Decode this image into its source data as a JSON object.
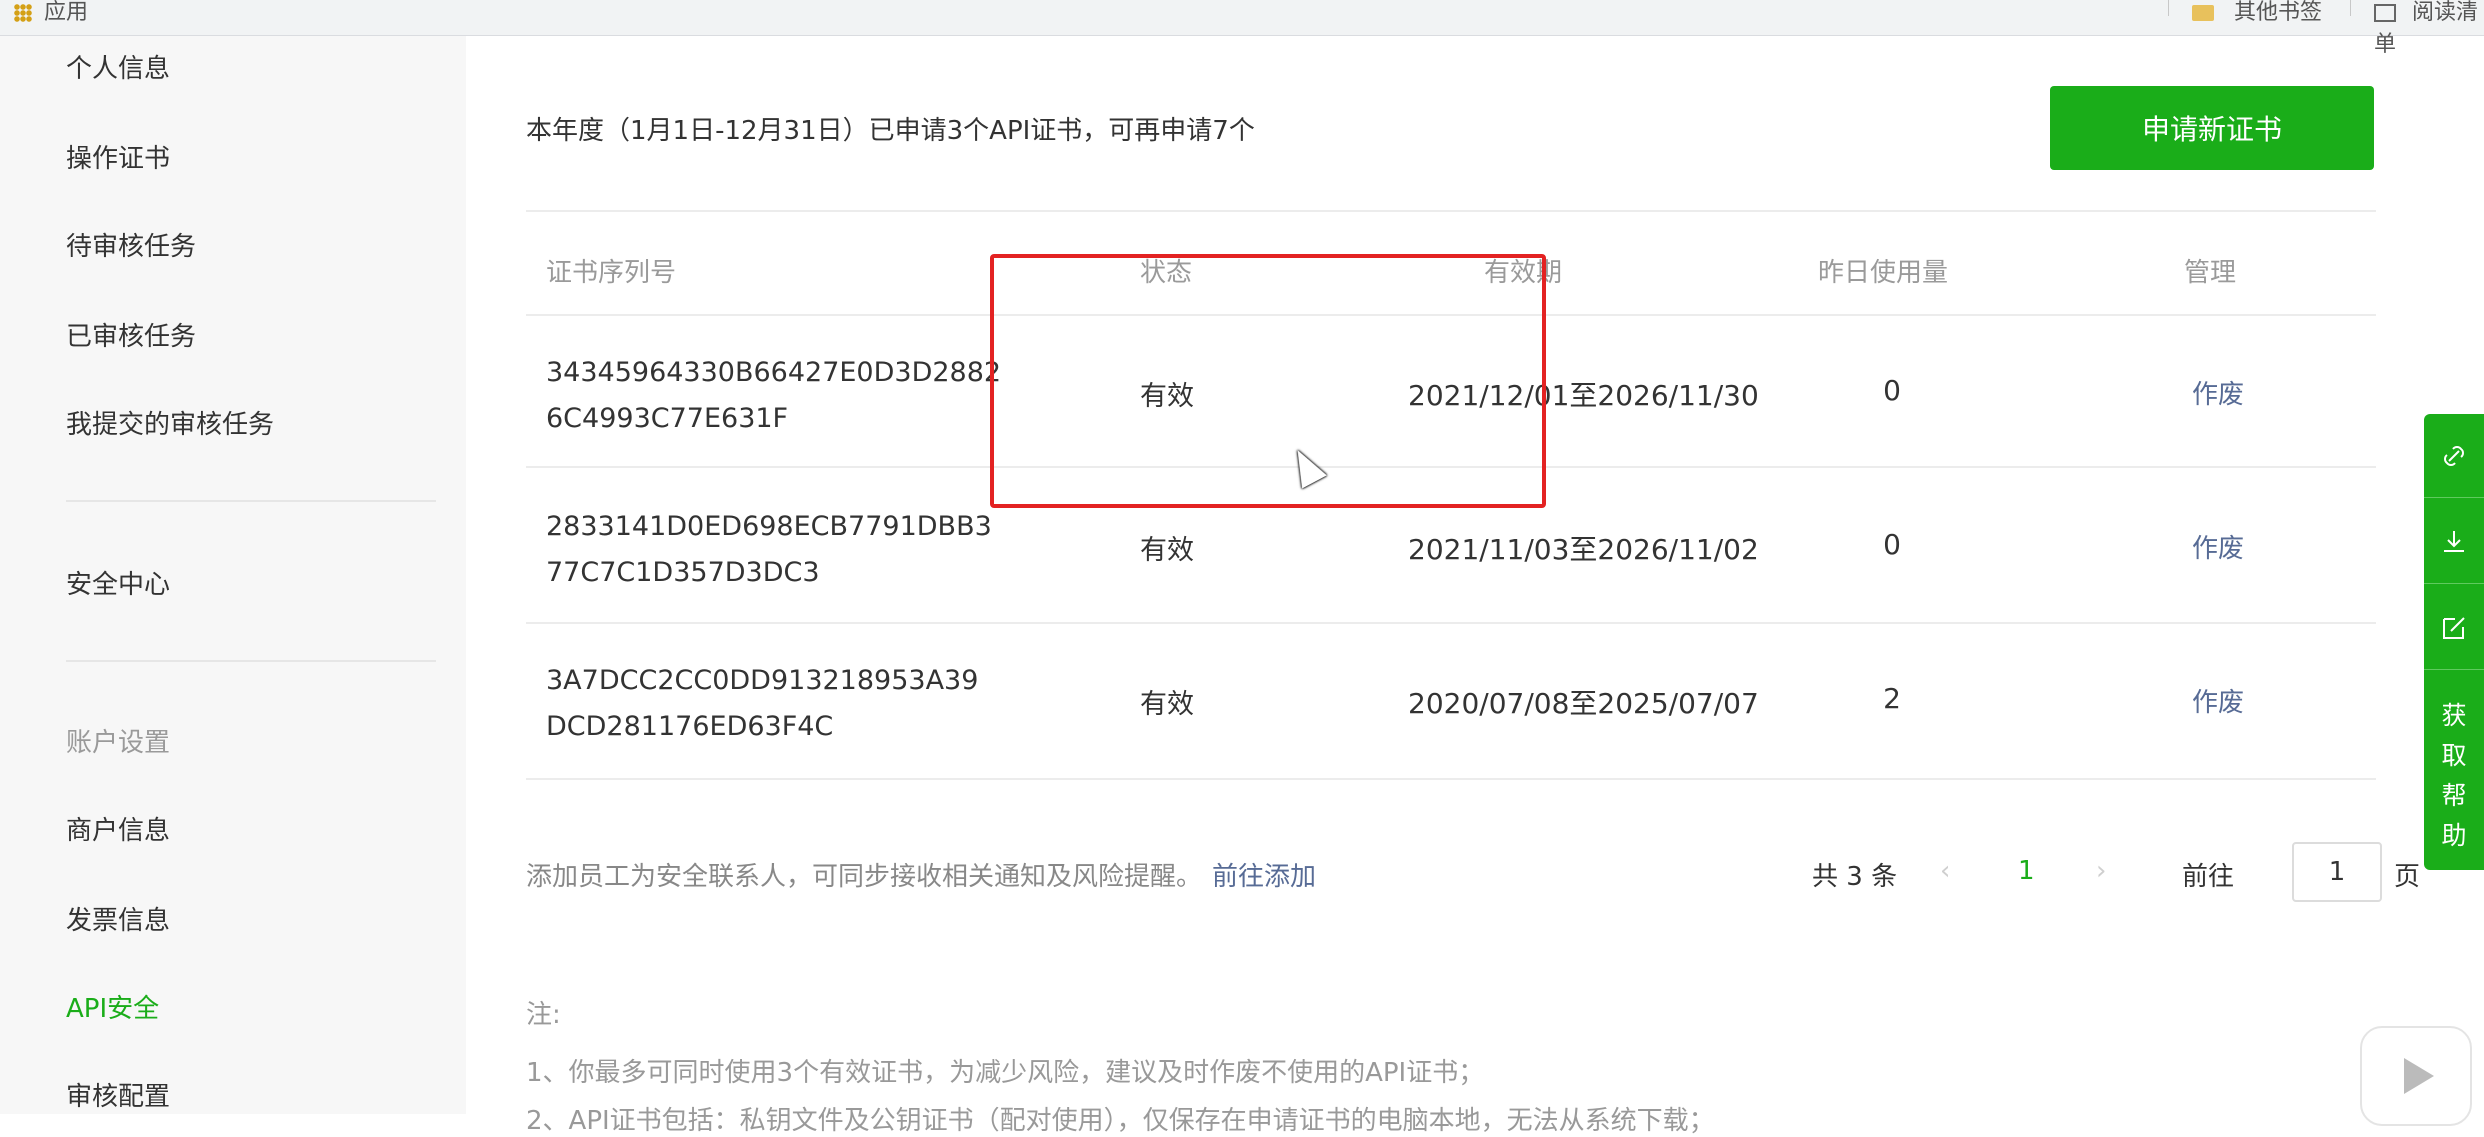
{
  "topbar": {
    "apps_label": "应用",
    "bookmarks": [
      "其他书签",
      "阅读清单"
    ]
  },
  "sidebar": {
    "items": [
      {
        "label": "个人信息",
        "type": "link"
      },
      {
        "label": "操作证书",
        "type": "link"
      },
      {
        "label": "待审核任务",
        "type": "link"
      },
      {
        "label": "已审核任务",
        "type": "link"
      },
      {
        "label": "我提交的审核任务",
        "type": "link"
      },
      {
        "label": "安全中心",
        "type": "link"
      },
      {
        "label": "账户设置",
        "type": "group"
      },
      {
        "label": "商户信息",
        "type": "link"
      },
      {
        "label": "发票信息",
        "type": "link"
      },
      {
        "label": "API安全",
        "type": "active"
      },
      {
        "label": "审核配置",
        "type": "link"
      }
    ]
  },
  "main": {
    "quota_text": "本年度（1月1日-12月31日）已申请3个API证书，可再申请7个",
    "apply_button": "申请新证书",
    "table": {
      "headers": [
        "证书序列号",
        "状态",
        "有效期",
        "昨日使用量",
        "管理"
      ],
      "rows": [
        {
          "serial_1": "34345964330B66427E0D3D2882",
          "serial_2": "6C4993C77E631F",
          "status": "有效",
          "validity": "2021/12/01至2026/11/30",
          "usage": "0",
          "action": "作废"
        },
        {
          "serial_1": "2833141D0ED698ECB7791DBB3",
          "serial_2": "77C7C1D357D3DC3",
          "status": "有效",
          "validity": "2021/11/03至2026/11/02",
          "usage": "0",
          "action": "作废"
        },
        {
          "serial_1": "3A7DCC2CC0DD913218953A39",
          "serial_2": "DCD281176ED63F4C",
          "status": "有效",
          "validity": "2020/07/08至2025/07/07",
          "usage": "2",
          "action": "作废"
        }
      ]
    },
    "contact_note": "添加员工为安全联系人，可同步接收相关通知及风险提醒。",
    "contact_link": "前往添加",
    "pagination": {
      "total": "共 3 条",
      "prev": "‹",
      "current": "1",
      "next": "›",
      "goto_label": "前往",
      "goto_value": "1",
      "page_suffix": "页"
    },
    "notes_title": "注:",
    "notes": [
      "1、你最多可同时使用3个有效证书，为减少风险，建议及时作废不使用的API证书；",
      "2、API证书包括：私钥文件及公钥证书（配对使用），仅保存在申请证书的电脑本地，无法从系统下载；"
    ]
  },
  "floating_bar": {
    "icons": [
      "link-icon",
      "download-icon",
      "edit-icon"
    ],
    "help_label": [
      "获",
      "取",
      "帮",
      "助"
    ]
  },
  "colors": {
    "accent": "#1aad19",
    "link": "#576b95",
    "highlight": "#e32222"
  }
}
